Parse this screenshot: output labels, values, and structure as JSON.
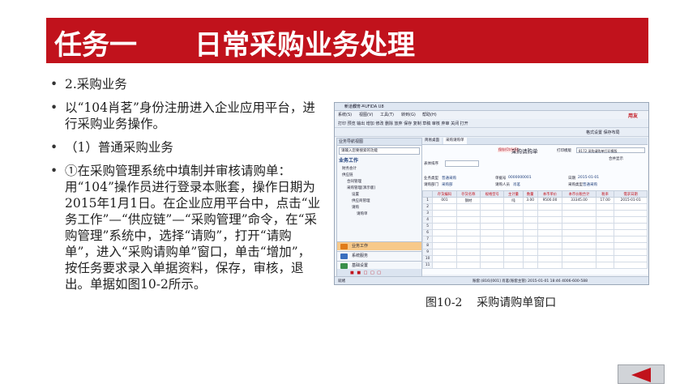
{
  "title": "任务一      日常采购业务处理",
  "bullets": [
    "2.采购业务",
    "以“104肖茗”身份注册进入企业应用平台，进行采购业务操作。",
    "（1）普通采购业务",
    "①在采购管理系统中填制并审核请购单：用“104”操作员进行登录本账套，操作日期为2015年1月1日。在企业应用平台中，点击“业务工作”—“供应链”—“采购管理”命令，在“采购管理”系统中，选择“请购”，打开“请购单”，进入“采购请购单”窗口，单击“增加”，按任务要求录入单据资料，保存，审核，退出。单据如图10-2所示。"
  ],
  "caption": "图10-2    采购请购单窗口",
  "screenshot": {
    "window_title": "新道教育—UFIDA U8",
    "menu": [
      "系统(S)",
      "视图(V)",
      "工具(T)",
      "转到(G)",
      "帮助(H)"
    ],
    "brand": "用友",
    "toolbar1": "打印  预览  输出  增加  修改  删除  放弃  保存  复制  草稿  审核  弃审  关闭  打开",
    "toolbar2": "格式设置  保存布局",
    "nav_header": "业务导航视图",
    "nav_input": "请输入您要搜索的功能",
    "nav_title": "业务工作",
    "tree": [
      "财务会计",
      "供应链",
      "合同管理",
      "采购管理[演示版]",
      "设置",
      "供应商管理",
      "请购",
      "请购单"
    ],
    "bottom_panes": [
      "业务工作",
      "系统服务",
      "基础设置"
    ],
    "tabs": [
      "简易桌面",
      "采购请购单"
    ],
    "doc_title": "采购请购单",
    "doc_flag": "保存(Ctrl+S)",
    "print_template_label": "打印模版",
    "print_template_value": "8172 采购请购单打印模版",
    "merge_label": "合并显示",
    "sort_label": "表体排序",
    "fields": {
      "business_type_label": "业务类型",
      "business_type_value": "普通采购",
      "doc_no_label": "单据号",
      "doc_no_value": "0000000001",
      "date_label": "日期",
      "date_value": "2015-01-01",
      "dept_label": "请购部门",
      "dept_value": "采购部",
      "person_label": "请购人员",
      "person_value": "肖茗",
      "ptype_label": "采购类型",
      "ptype_value": "普通采购"
    },
    "grid_headers": [
      "",
      "存货编码",
      "存货名称",
      "规格型号",
      "主计量",
      "数量",
      "本币单价",
      "本币价税合计",
      "税率",
      "需求日期"
    ],
    "grid_rows": [
      [
        "1",
        "001",
        "钢材",
        "",
        "吨",
        "3.00",
        "9500.00",
        "33345.00",
        "17.00",
        "2015-01-01"
      ],
      [
        "2",
        "",
        "",
        "",
        "",
        "",
        "",
        "",
        "",
        ""
      ],
      [
        "3",
        "",
        "",
        "",
        "",
        "",
        "",
        "",
        "",
        ""
      ],
      [
        "4",
        "",
        "",
        "",
        "",
        "",
        "",
        "",
        "",
        ""
      ],
      [
        "5",
        "",
        "",
        "",
        "",
        "",
        "",
        "",
        "",
        ""
      ],
      [
        "6",
        "",
        "",
        "",
        "",
        "",
        "",
        "",
        "",
        ""
      ],
      [
        "7",
        "",
        "",
        "",
        "",
        "",
        "",
        "",
        "",
        ""
      ],
      [
        "8",
        "",
        "",
        "",
        "",
        "",
        "",
        "",
        "",
        ""
      ],
      [
        "9",
        "",
        "",
        "",
        "",
        "",
        "",
        "",
        "",
        ""
      ],
      [
        "10",
        "",
        "",
        "",
        "",
        "",
        "",
        "",
        "",
        ""
      ],
      [
        "11",
        "",
        "",
        "",
        "",
        "",
        "",
        "",
        "",
        ""
      ]
    ],
    "status_left": "就绪",
    "status_right": "账套:(816)[001]  肖茗(账套主管)  2015-01-01 18:46  4006-600-588"
  },
  "colors": {
    "accent": "#c1121c",
    "nav_button": "#d1d4d8"
  }
}
